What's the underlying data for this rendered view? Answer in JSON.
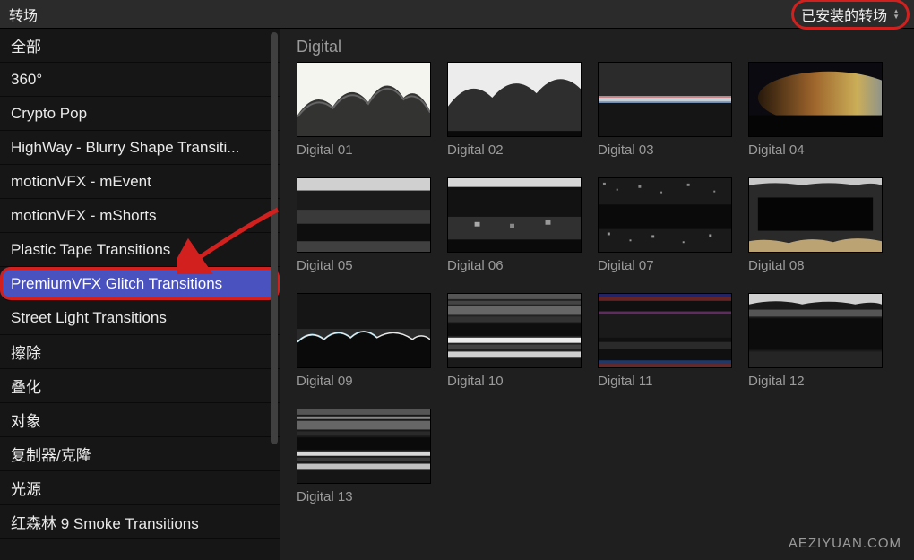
{
  "sidebar": {
    "title": "转场",
    "items": [
      {
        "label": "全部"
      },
      {
        "label": "360°"
      },
      {
        "label": "Crypto Pop"
      },
      {
        "label": "HighWay - Blurry Shape Transiti..."
      },
      {
        "label": "motionVFX - mEvent"
      },
      {
        "label": "motionVFX - mShorts"
      },
      {
        "label": "Plastic Tape Transitions"
      },
      {
        "label": "PremiumVFX Glitch Transitions",
        "selected": true,
        "highlight": true
      },
      {
        "label": "Street Light Transitions"
      },
      {
        "label": "擦除"
      },
      {
        "label": "叠化"
      },
      {
        "label": "对象"
      },
      {
        "label": "复制器/克隆"
      },
      {
        "label": "光源"
      },
      {
        "label": "红森林 9 Smoke Transitions"
      }
    ]
  },
  "header": {
    "dropdown_label": "已安装的转场"
  },
  "section": {
    "title": "Digital",
    "items": [
      {
        "label": "Digital 01"
      },
      {
        "label": "Digital 02"
      },
      {
        "label": "Digital 03"
      },
      {
        "label": "Digital 04"
      },
      {
        "label": "Digital 05"
      },
      {
        "label": "Digital 06"
      },
      {
        "label": "Digital 07"
      },
      {
        "label": "Digital 08"
      },
      {
        "label": "Digital 09"
      },
      {
        "label": "Digital 10"
      },
      {
        "label": "Digital 11"
      },
      {
        "label": "Digital 12"
      },
      {
        "label": "Digital 13"
      }
    ]
  },
  "watermark": "AEZIYUAN.COM"
}
